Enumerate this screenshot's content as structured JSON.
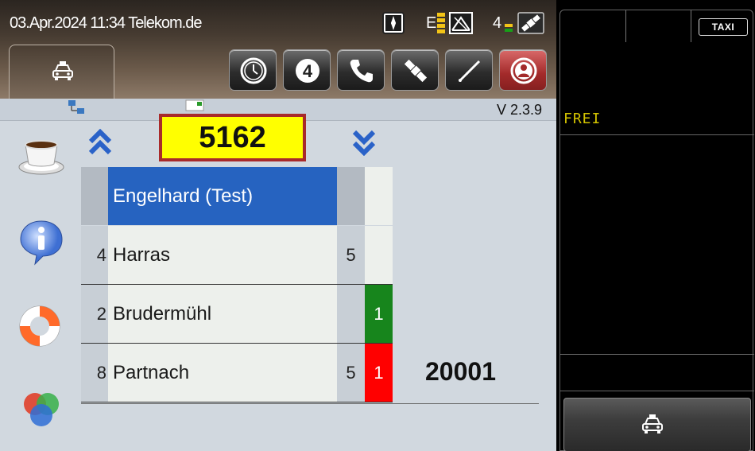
{
  "status": {
    "datetime_provider": "03.Apr.2024 11:34 Telekom.de",
    "network_label": "E",
    "gps_count": "4"
  },
  "toolbar": {
    "home_icon": "taxi-icon",
    "buttons": [
      {
        "icon": "clock-icon"
      },
      {
        "icon": "four-icon"
      },
      {
        "icon": "phone-icon"
      },
      {
        "icon": "satellite-icon"
      },
      {
        "icon": "screwdriver-icon"
      },
      {
        "icon": "person-icon"
      }
    ]
  },
  "info": {
    "version": "V 2.3.9"
  },
  "main": {
    "number": "5162",
    "queue": {
      "header": {
        "name": "Engelhard (Test)"
      },
      "rows": [
        {
          "num": "4",
          "name": "Harras",
          "cnt": "5",
          "flag": "",
          "flag_color": ""
        },
        {
          "num": "2",
          "name": "Brudermühl",
          "cnt": "",
          "flag": "1",
          "flag_color": "#17851c"
        },
        {
          "num": "8",
          "name": "Partnach",
          "cnt": "5",
          "flag": "1",
          "flag_color": "#ff0000"
        }
      ]
    },
    "id_number": "20001"
  },
  "right_panel": {
    "taxi_badge": "TAXI",
    "status": "FREI"
  },
  "colors": {
    "selected_row": "#2663c0",
    "number_box_bg": "#ffff00",
    "number_box_border": "#a82a2a",
    "status_text": "#d4c400"
  }
}
